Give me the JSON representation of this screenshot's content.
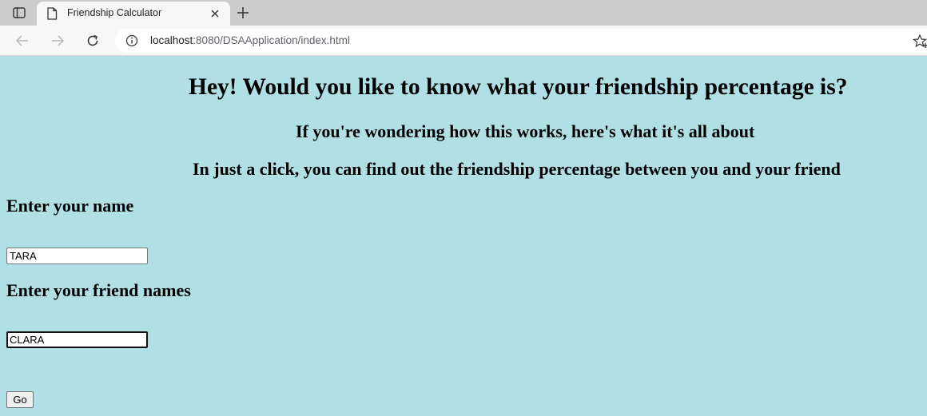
{
  "browser": {
    "tab_title": "Friendship Calculator",
    "url_host": "localhost",
    "url_rest": ":8080/DSAApplication/index.html"
  },
  "page": {
    "heading": "Hey! Would you like to know what your friendship percentage is?",
    "subheading_1": "If you're wondering how this works, here's what it's all about",
    "subheading_2": "In just a click, you can find out the friendship percentage between you and your friend",
    "name_label": "Enter your name",
    "name_value": "TARA",
    "friend_label": "Enter your friend names",
    "friend_value": "CLARA",
    "go_label": "Go"
  },
  "icons": {
    "tab_actions": "tab-actions-icon",
    "favicon": "page-icon",
    "close": "close-icon",
    "new_tab": "plus-icon",
    "back": "arrow-left-icon",
    "forward": "arrow-right-icon",
    "reload": "reload-icon",
    "info": "info-icon",
    "favorite": "star-plus-icon"
  },
  "colors": {
    "page_background": "#b0dfe5",
    "tabstrip": "#cccccc",
    "toolbar": "#f7f7f7"
  }
}
